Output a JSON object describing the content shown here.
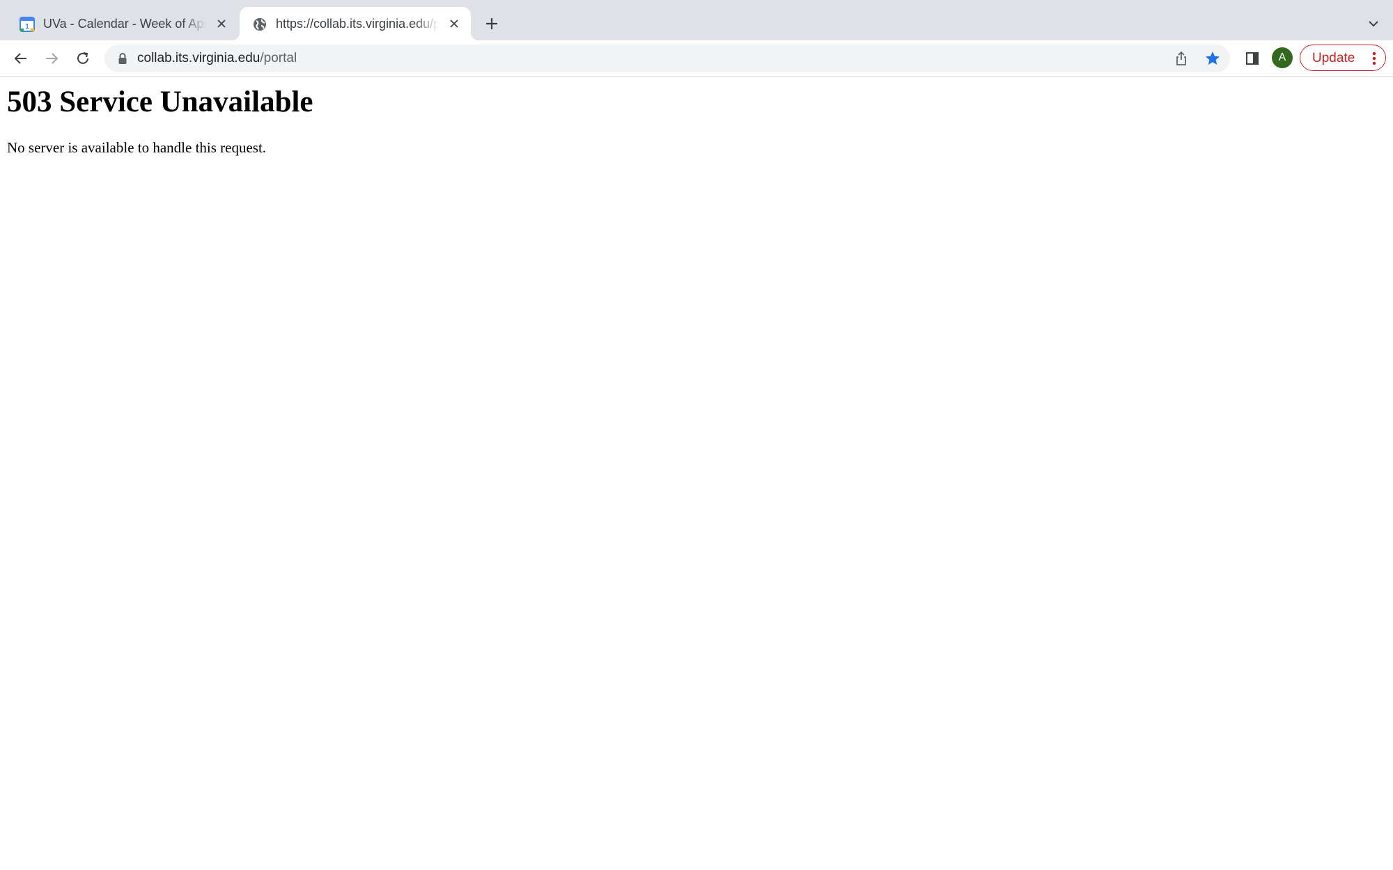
{
  "browser": {
    "tabs": [
      {
        "title": "UVa - Calendar - Week of April",
        "favicon": "google-calendar-icon",
        "active": false
      },
      {
        "title": "https://collab.its.virginia.edu/portal",
        "favicon": "globe-icon",
        "active": true
      }
    ],
    "address_bar": {
      "host": "collab.its.virginia.edu",
      "path": "/portal"
    },
    "profile_initial": "A",
    "update_label": "Update",
    "colors": {
      "tabstrip": "#dee1e6",
      "omnibox": "#f1f3f4",
      "avatar": "#33691e",
      "update_accent": "#c5221f",
      "bookmark_star": "#1a73e8"
    }
  },
  "page": {
    "heading": "503 Service Unavailable",
    "message": "No server is available to handle this request."
  }
}
